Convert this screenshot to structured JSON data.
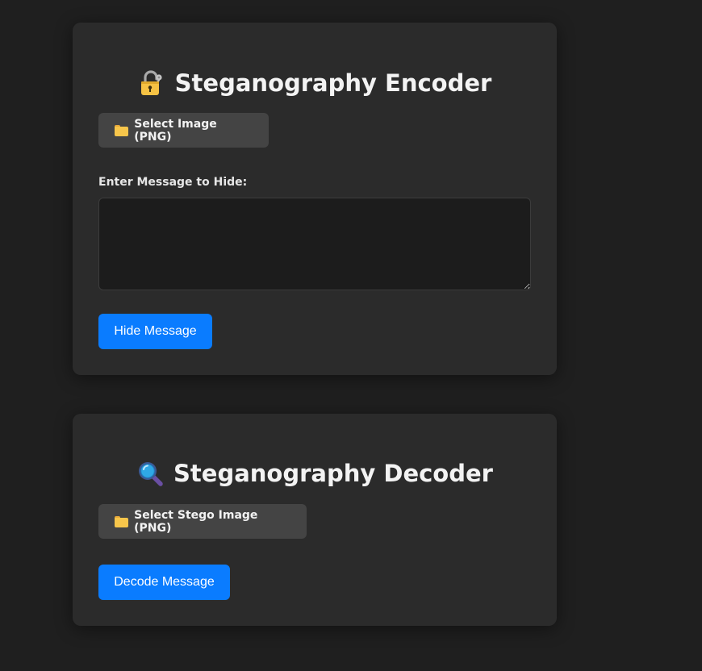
{
  "encoder": {
    "title": "Steganography Encoder",
    "title_icon": "lock-with-key-icon",
    "select_label": "Select Image (PNG)",
    "select_icon": "folder-icon",
    "message_label": "Enter Message to Hide:",
    "message_value": "",
    "submit_label": "Hide Message"
  },
  "decoder": {
    "title": "Steganography Decoder",
    "title_icon": "magnifying-glass-icon",
    "select_label": "Select Stego Image (PNG)",
    "select_icon": "folder-icon",
    "submit_label": "Decode Message"
  },
  "colors": {
    "page_background": "#1f1f1f",
    "card_background": "#2b2b2b",
    "file_button": "#444444",
    "primary_button": "#0a7cff",
    "textarea_background": "#1c1c1c"
  }
}
